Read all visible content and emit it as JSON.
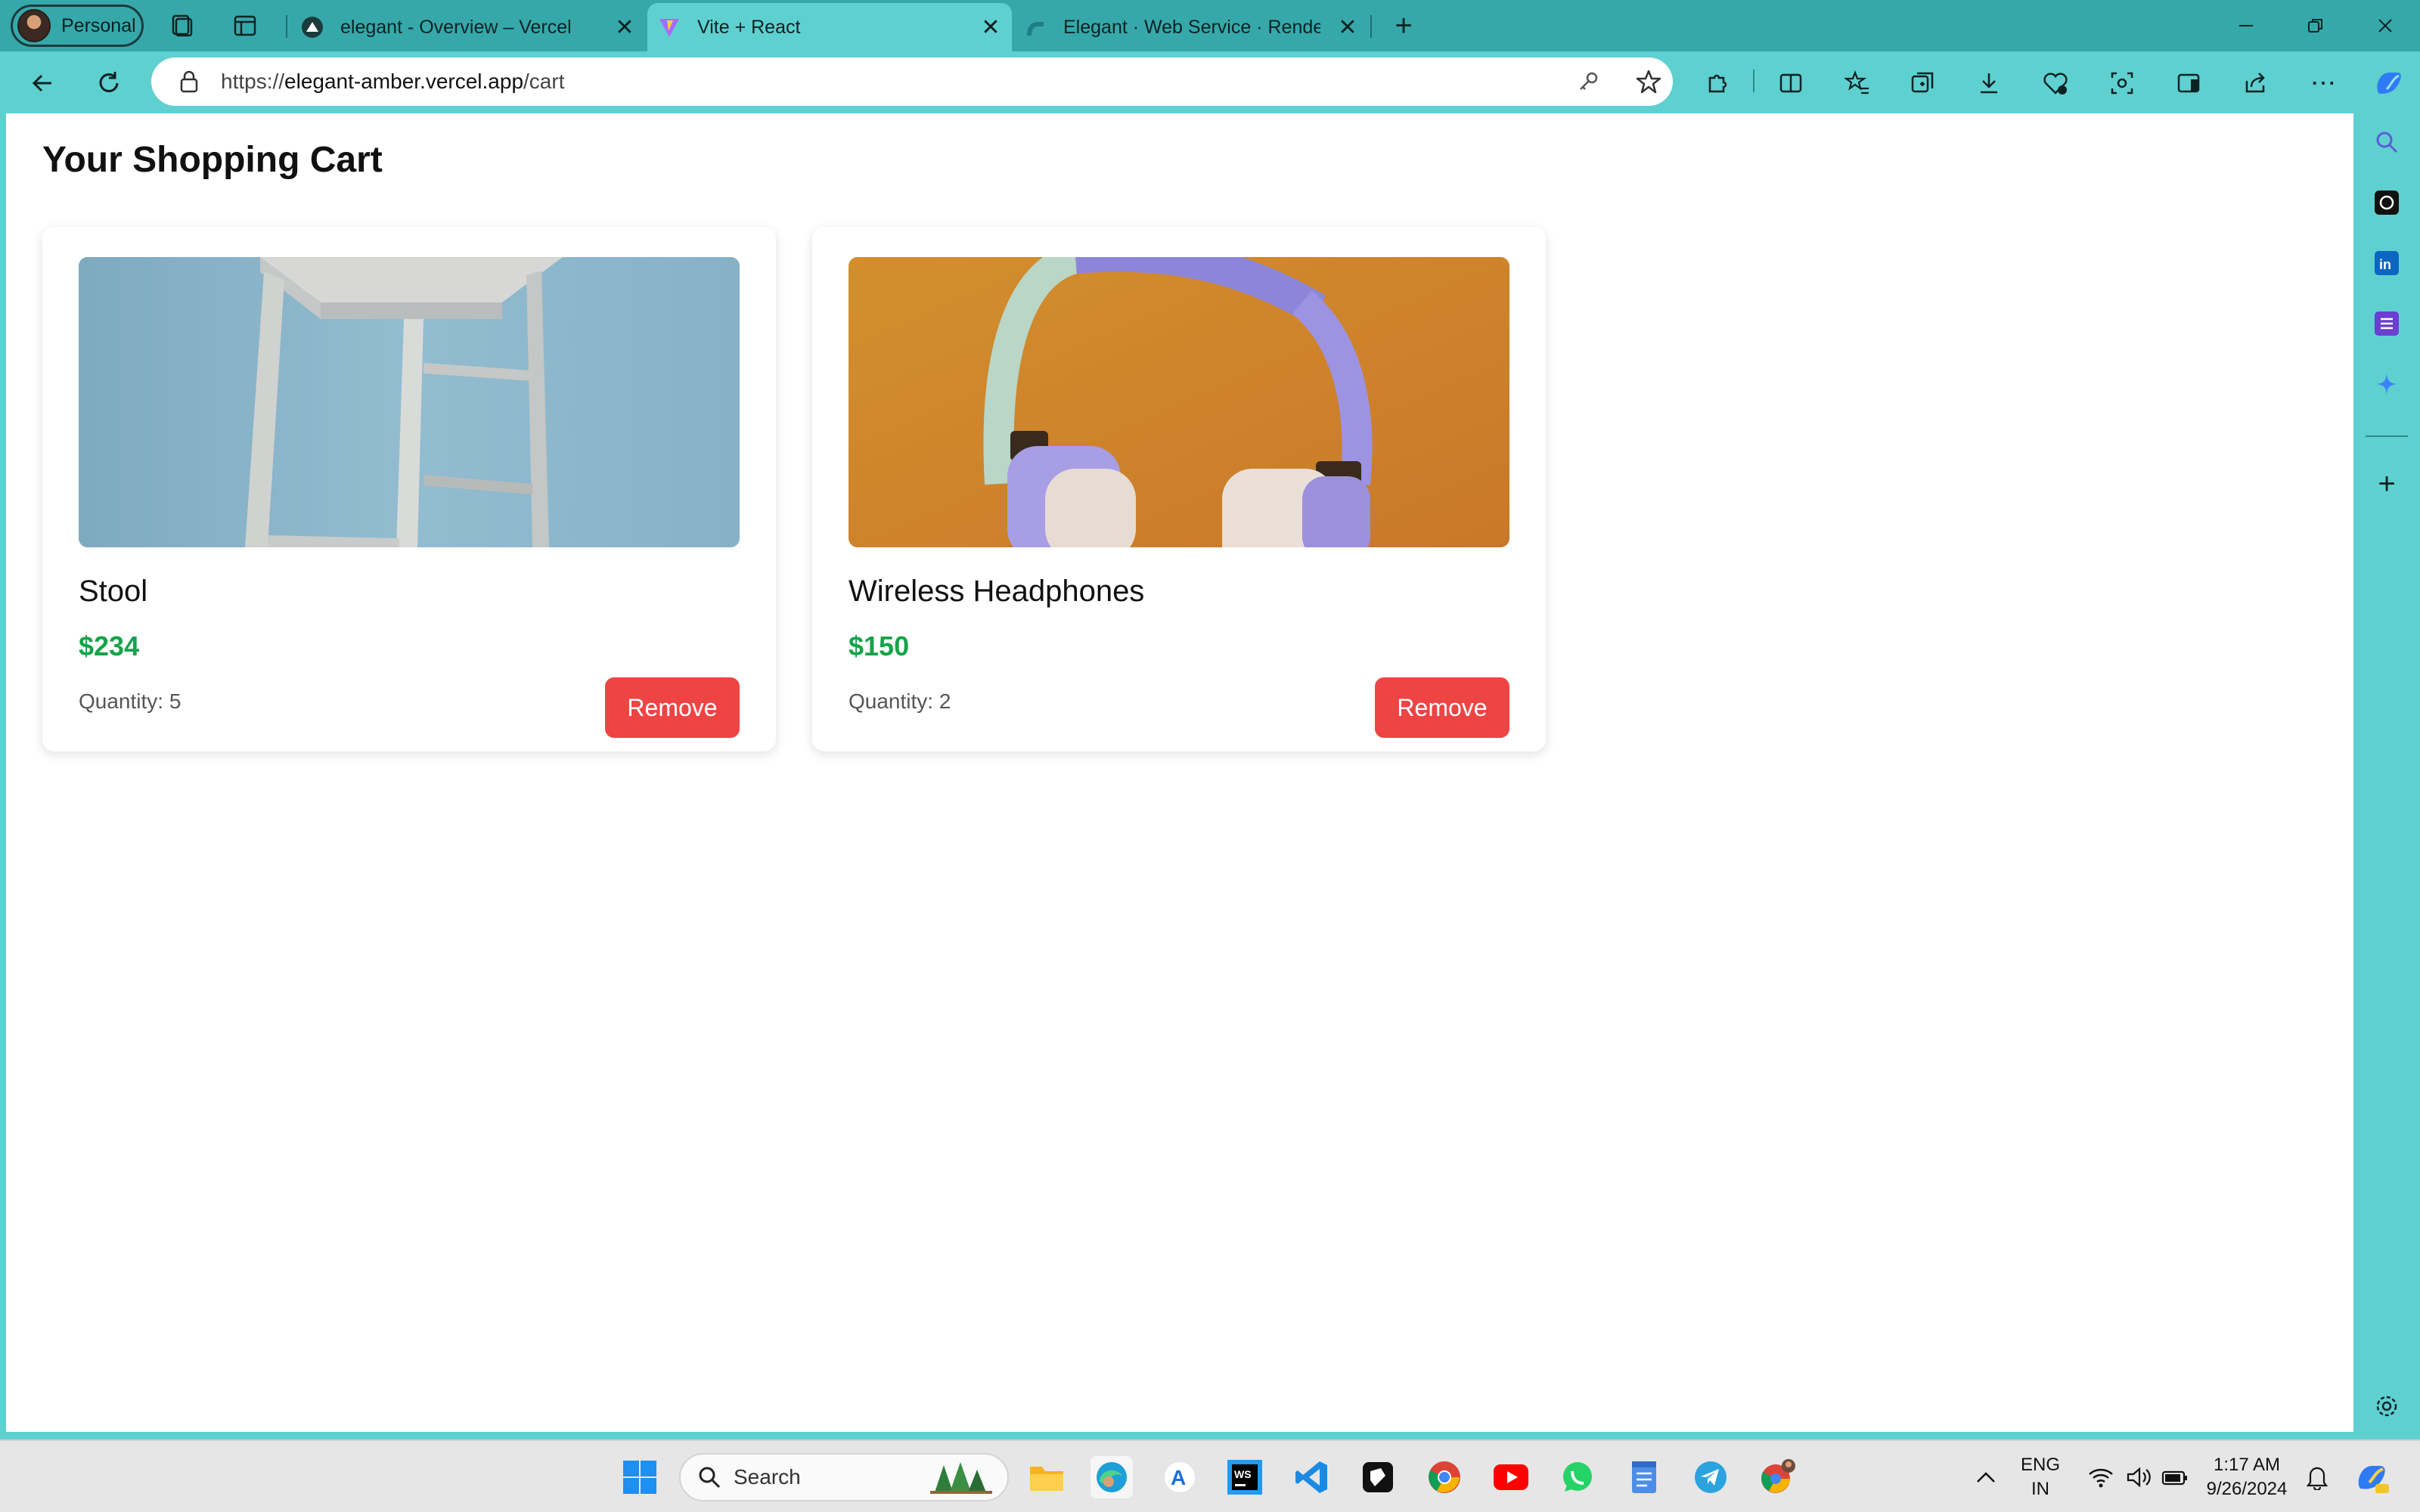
{
  "browser": {
    "profile_label": "Personal",
    "tabs": [
      {
        "title": "elegant - Overview – Vercel",
        "favicon": "vercel-icon"
      },
      {
        "title": "Vite + React",
        "favicon": "vite-icon"
      },
      {
        "title": "Elegant · Web Service · Render D",
        "favicon": "render-icon"
      }
    ],
    "address": {
      "url_prefix": "https://",
      "url_host": "elegant-amber.vercel.app",
      "url_path": "/cart"
    }
  },
  "page": {
    "title": "Your Shopping Cart",
    "cart_items": [
      {
        "name": "Stool",
        "price": "$234",
        "quantity": "Quantity: 5",
        "remove_label": "Remove"
      },
      {
        "name": "Wireless Headphones",
        "price": "$150",
        "quantity": "Quantity: 2",
        "remove_label": "Remove"
      }
    ]
  },
  "taskbar": {
    "search_placeholder": "Search",
    "language": "ENG",
    "region": "IN",
    "time": "1:17 AM",
    "date": "9/26/2024"
  },
  "colors": {
    "chrome": "#5fd0d0",
    "titlebar": "#36a8aa",
    "price_green": "#16a34a",
    "remove_red": "#ef4444"
  }
}
